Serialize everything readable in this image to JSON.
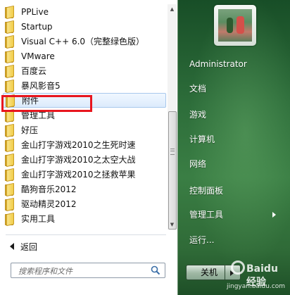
{
  "programs": [
    {
      "label": "PPLive"
    },
    {
      "label": "Startup"
    },
    {
      "label": "Visual C++ 6.0（完整绿色版）"
    },
    {
      "label": "VMware"
    },
    {
      "label": "百度云"
    },
    {
      "label": "暴风影音5"
    },
    {
      "label": "附件"
    },
    {
      "label": "管理工具"
    },
    {
      "label": "好压"
    },
    {
      "label": "金山打字游戏2010之生死时速"
    },
    {
      "label": "金山打字游戏2010之太空大战"
    },
    {
      "label": "金山打字游戏2010之拯救苹果"
    },
    {
      "label": "酷狗音乐2012"
    },
    {
      "label": "驱动精灵2012"
    },
    {
      "label": "实用工具"
    }
  ],
  "highlighted_item": "附件",
  "back_label": "返回",
  "search": {
    "placeholder": "搜索程序和文件"
  },
  "right_menu": {
    "user": "Administrator",
    "documents": "文档",
    "games": "游戏",
    "computer": "计算机",
    "network": "网络",
    "control_panel": "控制面板",
    "admin_tools": "管理工具",
    "run": "运行..."
  },
  "shutdown_label": "关机",
  "watermark": {
    "brand": "Baidu 经验",
    "url": "jingyan.baidu.com"
  },
  "colors": {
    "highlight_border": "#e8161e",
    "panel_green": "#2d6d3a"
  }
}
